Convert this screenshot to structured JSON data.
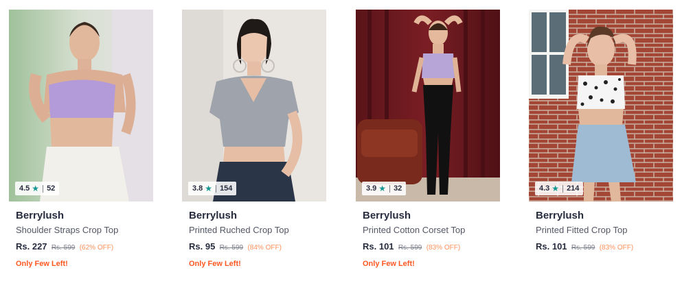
{
  "products": [
    {
      "brand": "Berrylush",
      "name": "Shoulder Straps Crop Top",
      "price": "Rs. 227",
      "mrp": "Rs. 599",
      "discount": "(62% OFF)",
      "rating": "4.5",
      "rating_count": "52",
      "stock_note": "Only Few Left!"
    },
    {
      "brand": "Berrylush",
      "name": "Printed Ruched Crop Top",
      "price": "Rs. 95",
      "mrp": "Rs. 599",
      "discount": "(84% OFF)",
      "rating": "3.8",
      "rating_count": "154",
      "stock_note": "Only Few Left!"
    },
    {
      "brand": "Berrylush",
      "name": "Printed Cotton Corset Top",
      "price": "Rs. 101",
      "mrp": "Rs. 599",
      "discount": "(83% OFF)",
      "rating": "3.9",
      "rating_count": "32",
      "stock_note": "Only Few Left!"
    },
    {
      "brand": "Berrylush",
      "name": "Printed Fitted Crop Top",
      "price": "Rs. 101",
      "mrp": "Rs. 599",
      "discount": "(83% OFF)",
      "rating": "4.3",
      "rating_count": "214",
      "stock_note": null
    }
  ],
  "icons": {
    "rating_star": "star-icon"
  },
  "colors": {
    "rating_star": "#14958f",
    "discount": "#ff905a",
    "stock_note": "#ff5722",
    "brand_text": "#282c3f"
  }
}
